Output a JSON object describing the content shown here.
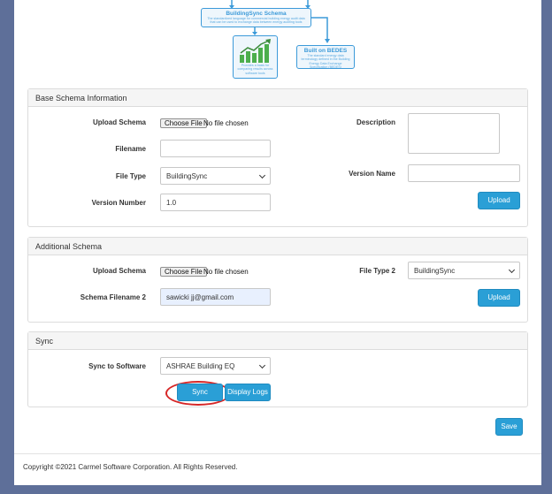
{
  "diagram": {
    "schema_box": {
      "title": "BuildingSync Schema",
      "subtitle": "The standardized language for commercial building energy audit data that can be used to exchange data between energy auditing tools"
    },
    "bedes_box": {
      "title": "Built on BEDES",
      "subtitle": "The standard energy data terminology defined in the Building Energy Data Exchange Specification (BEDES)"
    },
    "chart_box": {
      "subtitle": "Provides a basis for comparing results across software tools"
    }
  },
  "base_schema": {
    "header": "Base Schema Information",
    "upload_schema_label": "Upload Schema",
    "choose_file_label": "Choose File",
    "no_file_text": "No file chosen",
    "filename_label": "Filename",
    "filename_value": "",
    "file_type_label": "File Type",
    "file_type_value": "BuildingSync",
    "version_number_label": "Version Number",
    "version_number_value": "1.0",
    "description_label": "Description",
    "description_value": "",
    "version_name_label": "Version Name",
    "version_name_value": "",
    "upload_label": "Upload"
  },
  "additional_schema": {
    "header": "Additional Schema",
    "upload_schema_label": "Upload Schema",
    "choose_file_label": "Choose File",
    "no_file_text": "No file chosen",
    "file_type_label": "File Type 2",
    "file_type_value": "BuildingSync",
    "filename_label": "Schema Filename 2",
    "filename_value": "sawicki jj@gmail.com",
    "upload_label": "Upload"
  },
  "sync": {
    "header": "Sync",
    "software_label": "Sync to Software",
    "software_value": "ASHRAE Building EQ",
    "sync_label": "Sync",
    "logs_label": "Display Logs"
  },
  "save_label": "Save",
  "footer": "Copyright ©2021 Carmel Software Corporation. All Rights Reserved.",
  "colors": {
    "accent": "#2a9fd6",
    "highlight": "#d62626",
    "background": "#5e6f99"
  }
}
